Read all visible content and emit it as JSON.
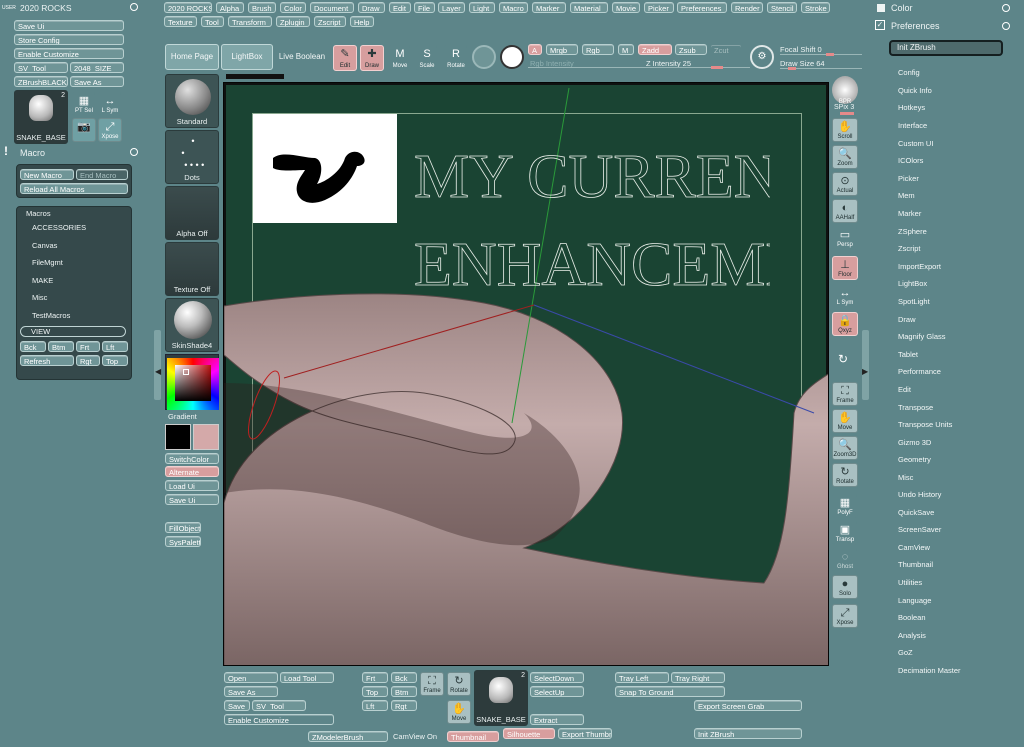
{
  "menubar": {
    "logo": "USER",
    "title": "2020 ROCKS",
    "items": [
      "2020 ROCKS",
      "Alpha",
      "Brush",
      "Color",
      "Document",
      "Draw",
      "Edit",
      "File",
      "Layer",
      "Light",
      "Macro",
      "Marker",
      "Material",
      "Movie",
      "Picker",
      "Preferences",
      "Render",
      "Stencil",
      "Stroke",
      "Texture",
      "Tool",
      "Transform",
      "Zplugin",
      "Zscript",
      "Help"
    ]
  },
  "left": {
    "buttons": [
      "Save Ui",
      "Store Config",
      "Enable Customize",
      "SV_Tool",
      "2048_SIZE",
      "ZBrushBLACK",
      "Save As"
    ],
    "tool_name": "SNAKE_BASE",
    "tool_count": "2",
    "pt_sel": "PT Sel",
    "l_sym": "L Sym",
    "xpose": "Xpose",
    "macro_title": "Macro",
    "new_macro": "New Macro",
    "end_macro": "End Macro",
    "reload": "Reload All Macros",
    "macros_title": "Macros",
    "macros": [
      "ACCESSORIES",
      "Canvas",
      "FileMgmt",
      "MAKE",
      "Misc",
      "TestMacros",
      "VIEW"
    ],
    "nav": [
      "Bck",
      "Btm",
      "Frt",
      "Lft",
      "Refresh",
      "Rgt",
      "Top"
    ]
  },
  "shelf": {
    "tiles": [
      "Standard",
      "Dots",
      "Alpha Off",
      "Texture Off",
      "SkinShade4"
    ],
    "gradient": "Gradient",
    "buttons": [
      "SwitchColor",
      "Alternate",
      "Load Ui",
      "Save Ui",
      "FillObject",
      "SysPalette"
    ]
  },
  "topbar": {
    "home": "Home Page",
    "lightbox": "LightBox",
    "live_boolean": "Live Boolean",
    "edit": "Edit",
    "draw": "Draw",
    "move": "Move",
    "scale": "Scale",
    "rotate": "Rotate",
    "a": "A",
    "mrgb": "Mrgb",
    "rgb": "Rgb",
    "m": "M",
    "zadd": "Zadd",
    "zsub": "Zsub",
    "zcut": "Zcut",
    "rgb_intensity": "Rgb Intensity",
    "z_intensity": "Z Intensity 25",
    "focal_shift": "Focal Shift 0",
    "draw_size": "Draw Size 64"
  },
  "canvas": {
    "line1": "MY CURRENT UI",
    "line2": "ENHANCEMENTS"
  },
  "righttools": [
    "BPR",
    "SPix 3",
    "Scroll",
    "Zoom",
    "Actual",
    "AAHalf",
    "Persp",
    "Floor",
    "L Sym",
    "Qxyz",
    "Frame",
    "Move",
    "Zoom3D",
    "Rotate",
    "PolyF",
    "Transp",
    "Ghost",
    "Solo",
    "Xpose"
  ],
  "prefs": {
    "color": "Color",
    "preferences": "Preferences",
    "init": "Init ZBrush",
    "items": [
      "Config",
      "Quick Info",
      "Hotkeys",
      "Interface",
      "Custom UI",
      "ICOlors",
      "Picker",
      "Mem",
      "Marker",
      "ZSphere",
      "Zscript",
      "ImportExport",
      "LightBox",
      "SpotLight",
      "Draw",
      "Magnify Glass",
      "Tablet",
      "Performance",
      "Edit",
      "Transpose",
      "Transpose Units",
      "Gizmo 3D",
      "Geometry",
      "Misc",
      "Undo History",
      "QuickSave",
      "ScreenSaver",
      "CamView",
      "Thumbnail",
      "Utilities",
      "Language",
      "Boolean",
      "Analysis",
      "GoZ",
      "Decimation Master"
    ]
  },
  "bottom": {
    "open": "Open",
    "load_tool": "Load Tool",
    "save_as": "Save As",
    "save": "Save",
    "sv_tool": "SV_Tool",
    "enable_customize": "Enable Customize",
    "zmodeler": "ZModelerBrush",
    "camview": "CamView On",
    "thumbnail": "Thumbnail",
    "silhouette": "Silhouette",
    "export_thumb": "Export Thumbn",
    "frt": "Frt",
    "bck": "Bck",
    "top": "Top",
    "btm": "Btm",
    "lft": "Lft",
    "rgt": "Rgt",
    "frame": "Frame",
    "rotate": "Rotate",
    "move": "Move",
    "tool_name": "SNAKE_BASE",
    "tool_count": "2",
    "select_down": "SelectDown",
    "select_up": "SelectUp",
    "extract": "Extract",
    "tray_left": "Tray Left",
    "tray_right": "Tray Right",
    "snap": "Snap To Ground",
    "export_grab": "Export Screen Grab",
    "init": "Init ZBrush"
  }
}
